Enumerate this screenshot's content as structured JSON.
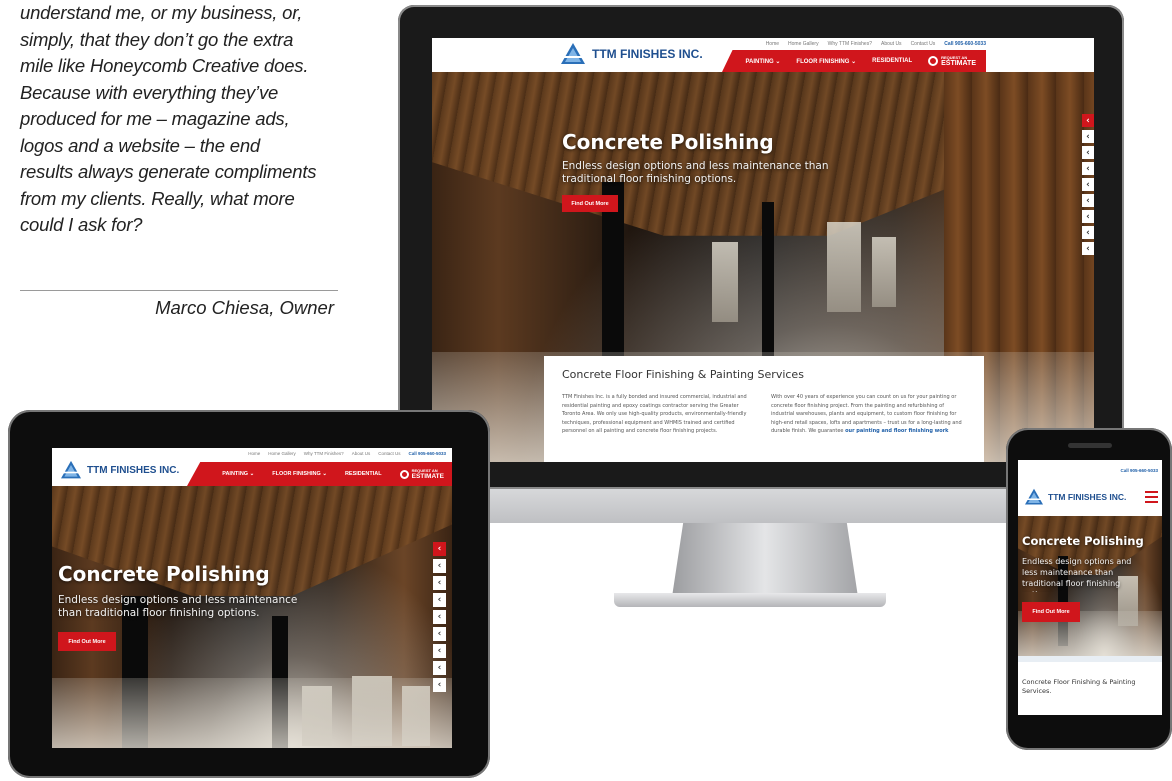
{
  "testimonial": {
    "lines": [
      "understand me, or my business, or,",
      "simply, that they don’t go the extra",
      "mile like Honeycomb Creative does.",
      "Because with everything they’ve",
      "produced for me – magazine ads,",
      "logos and a website – the end",
      "results always generate compliments",
      "from my clients. Really, what more",
      "could I ask for?"
    ],
    "author": "Marco Chiesa, Owner"
  },
  "site": {
    "logo_text": "TTM FINISHES INC.",
    "top_links": [
      "Home",
      "Home Gallery",
      "Why TTM Finishes?",
      "About Us",
      "Contact Us"
    ],
    "phone": "Call 905-660-5033",
    "nav": [
      "PAINTING ⌄",
      "FLOOR FINISHING ⌄",
      "RESIDENTIAL"
    ],
    "estimate_top": "REQUEST AN",
    "estimate_bottom": "ESTIMATE",
    "hero_title": "Concrete Polishing",
    "hero_sub_line1": "Endless design options and less maintenance than",
    "hero_sub_line2": "traditional floor finishing options.",
    "hero_sub_tab1": "Endless design options and less maintenance",
    "hero_sub_tab2": "than traditional floor finishing options.",
    "hero_button": "Find Out More",
    "section_title": "Concrete Floor Finishing & Painting Services",
    "phone_section_title": "Concrete Floor Finishing & Painting Services.",
    "col1": "TTM Finishes Inc. is a fully bonded and insured commercial, industrial and residential painting and epoxy coatings contractor serving the Greater Toronto Area. We only use high-quality products, environmentally-friendly techniques, professional equipment and WHMIS trained and certified personnel on all painting and concrete floor finishing projects.",
    "col2": "With over 40 years of experience you can count on us for your painting or concrete floor finishing project. From the painting and refurbishing of industrial warehouses, plants and equipment, to custom floor finishing for high-end retail spaces, lofts and apartments – trust us for a long-lasting and durable finish. We guarantee",
    "col2_link": "our painting and floor finishing work",
    "share_arrow": "‹",
    "phone_sub": "Endless design options and less maintenance than traditional floor finishing options."
  },
  "colors": {
    "brand_red": "#d0161c",
    "brand_blue": "#1f4f8f"
  }
}
